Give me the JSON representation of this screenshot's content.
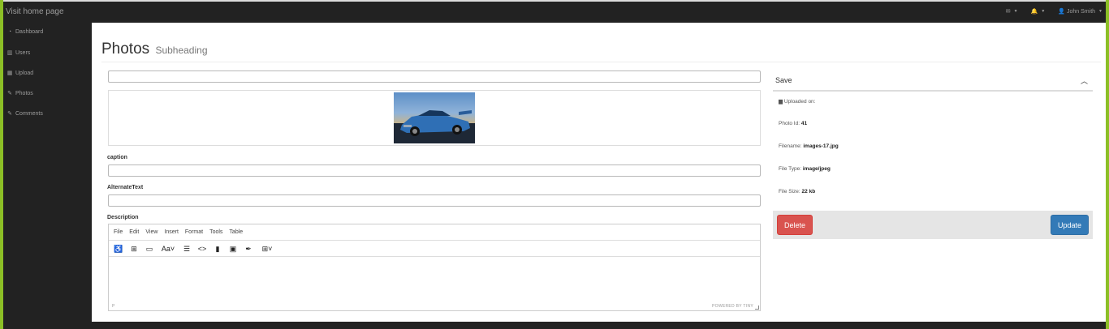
{
  "navbar": {
    "brand": "Visit home page",
    "mail_icon": "envelope-icon",
    "bell_icon": "bell-icon",
    "user_name": "John Smith"
  },
  "sidebar": {
    "items": [
      {
        "label": "Dashboard",
        "icon": "dashboard-icon"
      },
      {
        "label": "Users",
        "icon": "bar-chart-icon"
      },
      {
        "label": "Upload",
        "icon": "table-icon"
      },
      {
        "label": "Photos",
        "icon": "edit-icon"
      },
      {
        "label": "Comments",
        "icon": "edit-icon"
      }
    ]
  },
  "page": {
    "title": "Photos",
    "subheading": "Subheading"
  },
  "form": {
    "title_value": "",
    "caption_label": "caption",
    "caption_value": "",
    "alt_label": "AlternateText",
    "alt_value": "",
    "description_label": "Description"
  },
  "editor": {
    "menu": [
      "File",
      "Edit",
      "View",
      "Insert",
      "Format",
      "Tools",
      "Table"
    ],
    "status_path": "P",
    "powered_by": "POWERED BY TINY"
  },
  "panel": {
    "title": "Save",
    "uploaded_label": "Uploaded on:",
    "uploaded_value": "",
    "photo_id_label": "Photo Id:",
    "photo_id_value": "41",
    "filename_label": "Filename:",
    "filename_value": "images-17.jpg",
    "filetype_label": "File Type:",
    "filetype_value": "image/jpeg",
    "filesize_label": "File Size:",
    "filesize_value": "22 kb",
    "delete_label": "Delete",
    "update_label": "Update"
  },
  "colors": {
    "accent_frame": "#8cbf26",
    "delete": "#d9534f",
    "update": "#337ab7",
    "navbar": "#222222"
  }
}
